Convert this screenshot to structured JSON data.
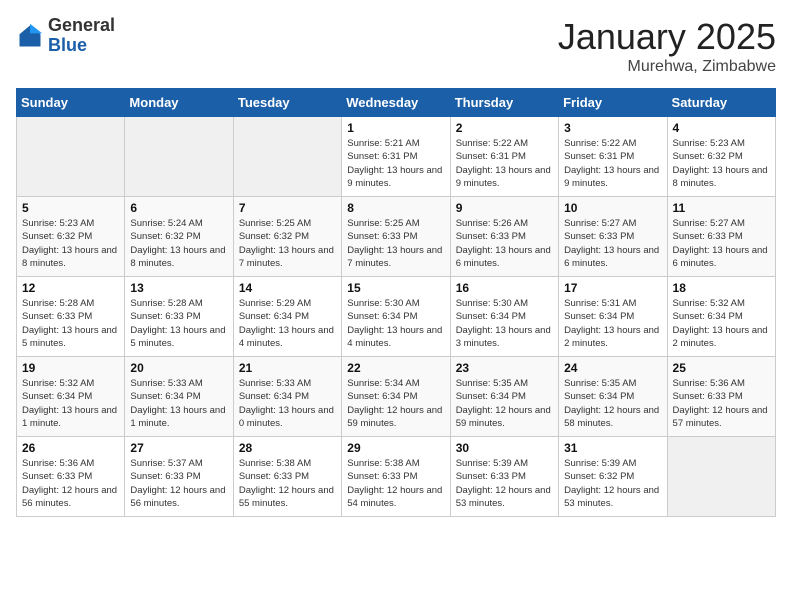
{
  "logo": {
    "general": "General",
    "blue": "Blue"
  },
  "header": {
    "title": "January 2025",
    "location": "Murehwa, Zimbabwe"
  },
  "weekdays": [
    "Sunday",
    "Monday",
    "Tuesday",
    "Wednesday",
    "Thursday",
    "Friday",
    "Saturday"
  ],
  "weeks": [
    [
      {
        "day": "",
        "info": ""
      },
      {
        "day": "",
        "info": ""
      },
      {
        "day": "",
        "info": ""
      },
      {
        "day": "1",
        "info": "Sunrise: 5:21 AM\nSunset: 6:31 PM\nDaylight: 13 hours\nand 9 minutes."
      },
      {
        "day": "2",
        "info": "Sunrise: 5:22 AM\nSunset: 6:31 PM\nDaylight: 13 hours\nand 9 minutes."
      },
      {
        "day": "3",
        "info": "Sunrise: 5:22 AM\nSunset: 6:31 PM\nDaylight: 13 hours\nand 9 minutes."
      },
      {
        "day": "4",
        "info": "Sunrise: 5:23 AM\nSunset: 6:32 PM\nDaylight: 13 hours\nand 8 minutes."
      }
    ],
    [
      {
        "day": "5",
        "info": "Sunrise: 5:23 AM\nSunset: 6:32 PM\nDaylight: 13 hours\nand 8 minutes."
      },
      {
        "day": "6",
        "info": "Sunrise: 5:24 AM\nSunset: 6:32 PM\nDaylight: 13 hours\nand 8 minutes."
      },
      {
        "day": "7",
        "info": "Sunrise: 5:25 AM\nSunset: 6:32 PM\nDaylight: 13 hours\nand 7 minutes."
      },
      {
        "day": "8",
        "info": "Sunrise: 5:25 AM\nSunset: 6:33 PM\nDaylight: 13 hours\nand 7 minutes."
      },
      {
        "day": "9",
        "info": "Sunrise: 5:26 AM\nSunset: 6:33 PM\nDaylight: 13 hours\nand 6 minutes."
      },
      {
        "day": "10",
        "info": "Sunrise: 5:27 AM\nSunset: 6:33 PM\nDaylight: 13 hours\nand 6 minutes."
      },
      {
        "day": "11",
        "info": "Sunrise: 5:27 AM\nSunset: 6:33 PM\nDaylight: 13 hours\nand 6 minutes."
      }
    ],
    [
      {
        "day": "12",
        "info": "Sunrise: 5:28 AM\nSunset: 6:33 PM\nDaylight: 13 hours\nand 5 minutes."
      },
      {
        "day": "13",
        "info": "Sunrise: 5:28 AM\nSunset: 6:33 PM\nDaylight: 13 hours\nand 5 minutes."
      },
      {
        "day": "14",
        "info": "Sunrise: 5:29 AM\nSunset: 6:34 PM\nDaylight: 13 hours\nand 4 minutes."
      },
      {
        "day": "15",
        "info": "Sunrise: 5:30 AM\nSunset: 6:34 PM\nDaylight: 13 hours\nand 4 minutes."
      },
      {
        "day": "16",
        "info": "Sunrise: 5:30 AM\nSunset: 6:34 PM\nDaylight: 13 hours\nand 3 minutes."
      },
      {
        "day": "17",
        "info": "Sunrise: 5:31 AM\nSunset: 6:34 PM\nDaylight: 13 hours\nand 2 minutes."
      },
      {
        "day": "18",
        "info": "Sunrise: 5:32 AM\nSunset: 6:34 PM\nDaylight: 13 hours\nand 2 minutes."
      }
    ],
    [
      {
        "day": "19",
        "info": "Sunrise: 5:32 AM\nSunset: 6:34 PM\nDaylight: 13 hours\nand 1 minute."
      },
      {
        "day": "20",
        "info": "Sunrise: 5:33 AM\nSunset: 6:34 PM\nDaylight: 13 hours\nand 1 minute."
      },
      {
        "day": "21",
        "info": "Sunrise: 5:33 AM\nSunset: 6:34 PM\nDaylight: 13 hours\nand 0 minutes."
      },
      {
        "day": "22",
        "info": "Sunrise: 5:34 AM\nSunset: 6:34 PM\nDaylight: 12 hours\nand 59 minutes."
      },
      {
        "day": "23",
        "info": "Sunrise: 5:35 AM\nSunset: 6:34 PM\nDaylight: 12 hours\nand 59 minutes."
      },
      {
        "day": "24",
        "info": "Sunrise: 5:35 AM\nSunset: 6:34 PM\nDaylight: 12 hours\nand 58 minutes."
      },
      {
        "day": "25",
        "info": "Sunrise: 5:36 AM\nSunset: 6:33 PM\nDaylight: 12 hours\nand 57 minutes."
      }
    ],
    [
      {
        "day": "26",
        "info": "Sunrise: 5:36 AM\nSunset: 6:33 PM\nDaylight: 12 hours\nand 56 minutes."
      },
      {
        "day": "27",
        "info": "Sunrise: 5:37 AM\nSunset: 6:33 PM\nDaylight: 12 hours\nand 56 minutes."
      },
      {
        "day": "28",
        "info": "Sunrise: 5:38 AM\nSunset: 6:33 PM\nDaylight: 12 hours\nand 55 minutes."
      },
      {
        "day": "29",
        "info": "Sunrise: 5:38 AM\nSunset: 6:33 PM\nDaylight: 12 hours\nand 54 minutes."
      },
      {
        "day": "30",
        "info": "Sunrise: 5:39 AM\nSunset: 6:33 PM\nDaylight: 12 hours\nand 53 minutes."
      },
      {
        "day": "31",
        "info": "Sunrise: 5:39 AM\nSunset: 6:32 PM\nDaylight: 12 hours\nand 53 minutes."
      },
      {
        "day": "",
        "info": ""
      }
    ]
  ]
}
